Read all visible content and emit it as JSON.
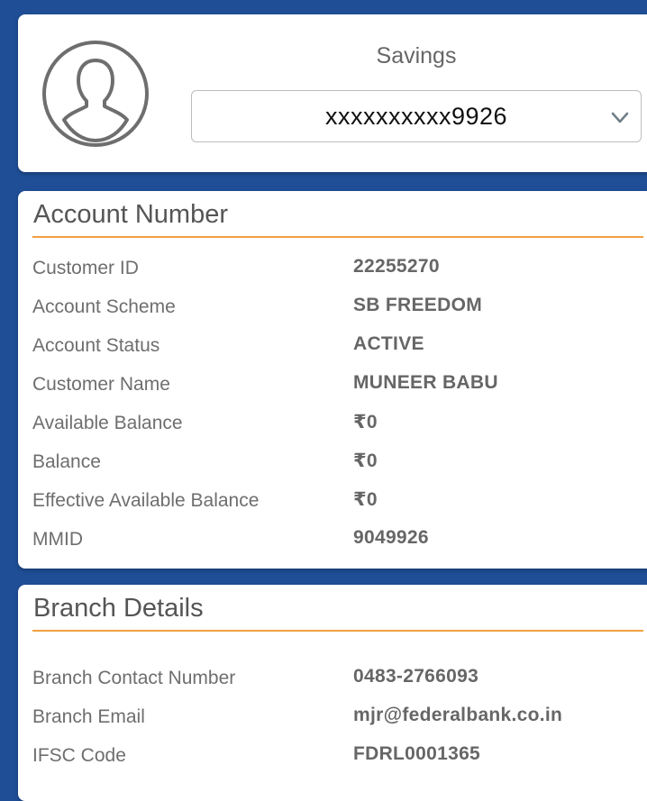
{
  "profile": {
    "avatar_icon": "user-avatar-icon",
    "account_type": "Savings",
    "account_number_masked": "xxxxxxxxxx9926",
    "dropdown_icon": "chevron-down-icon"
  },
  "account_section": {
    "title": "Account Number",
    "rows": [
      {
        "label": "Customer ID",
        "value": "22255270"
      },
      {
        "label": "Account Scheme",
        "value": "SB FREEDOM"
      },
      {
        "label": "Account Status",
        "value": "ACTIVE"
      },
      {
        "label": "Customer Name",
        "value": "MUNEER BABU"
      },
      {
        "label": "Available Balance",
        "value": "₹0"
      },
      {
        "label": "Balance",
        "value": "₹0"
      },
      {
        "label": "Effective Available Balance",
        "value": "₹0"
      },
      {
        "label": "MMID",
        "value": "9049926"
      }
    ]
  },
  "branch_section": {
    "title": "Branch Details",
    "rows": [
      {
        "label": "Branch Contact Number",
        "value": "0483-2766093"
      },
      {
        "label": "Branch Email",
        "value": "mjr@federalbank.co.in"
      },
      {
        "label": "IFSC Code",
        "value": "FDRL0001365"
      }
    ]
  },
  "colors": {
    "background": "#1f4e96",
    "accent_rule": "#f0a040",
    "card": "#ffffff"
  }
}
